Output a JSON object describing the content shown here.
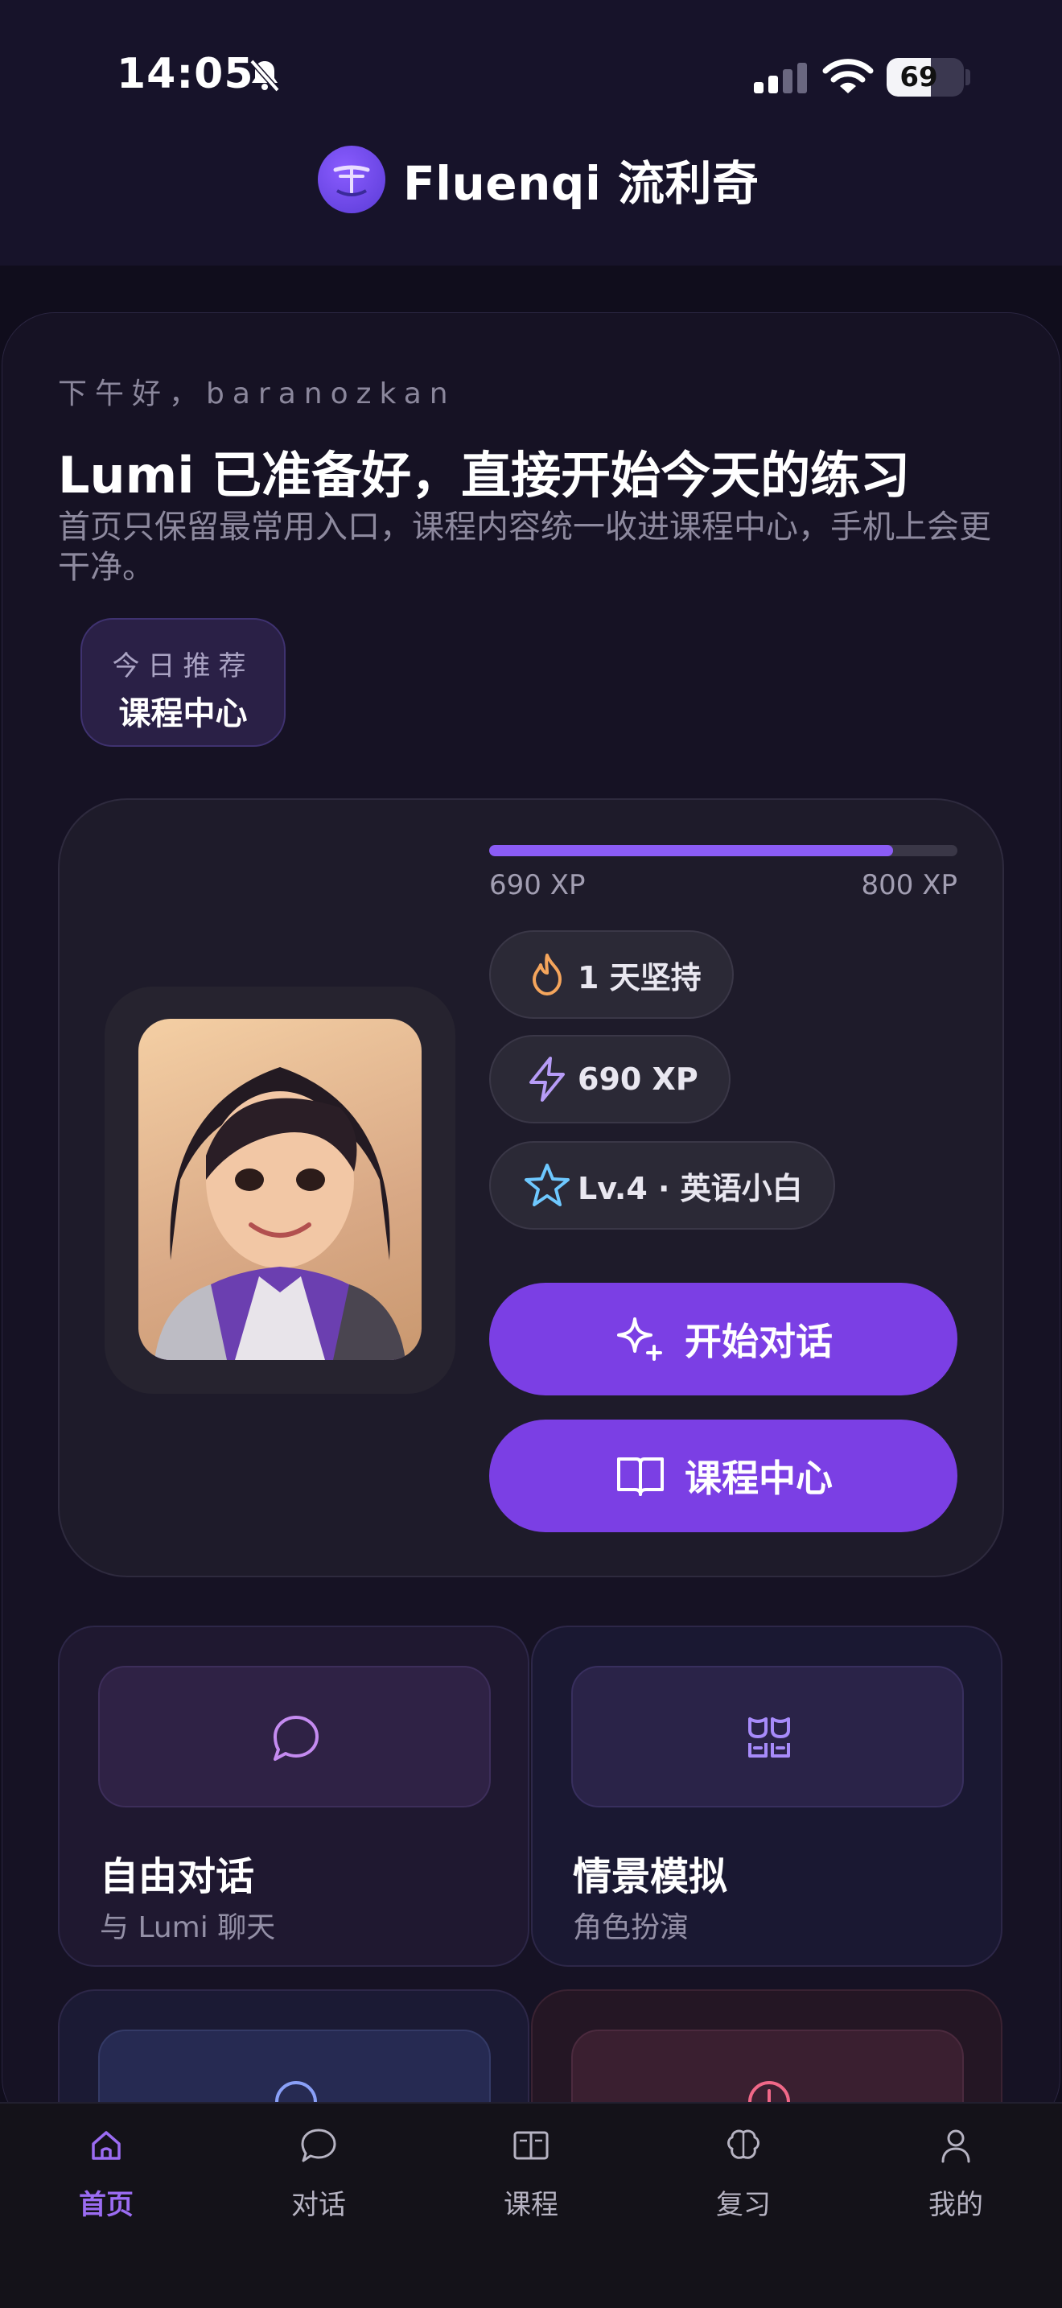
{
  "status": {
    "time": "14:05",
    "battery": "69"
  },
  "brand": {
    "name": "Fluenqi 流利奇"
  },
  "greeting": "下午好，baranozkan",
  "headline": "Lumi 已准备好，直接开始今天的练习",
  "subline": "首页只保留最常用入口，课程内容统一收进课程中心，手机上会更干净。",
  "recommend": {
    "label": "今日推荐",
    "value": "课程中心"
  },
  "xp": {
    "current": "690 XP",
    "target": "800 XP",
    "progress": 0.8625
  },
  "stats": [
    {
      "icon": "flame-icon",
      "text": "1 天坚持",
      "color": "#f5a55c"
    },
    {
      "icon": "lightning-icon",
      "text": "690 XP",
      "color": "#b79cf7"
    },
    {
      "icon": "star-icon",
      "text": "Lv.4 · 英语小白",
      "color": "#6ec8ff"
    }
  ],
  "actions": {
    "start_chat": "开始对话",
    "course_center": "课程中心"
  },
  "features": [
    {
      "title": "自由对话",
      "subtitle": "与 Lumi 聊天",
      "icon": "chat-bubble-icon"
    },
    {
      "title": "情景模拟",
      "subtitle": "角色扮演",
      "icon": "theater-masks-icon"
    }
  ],
  "tabs": [
    {
      "label": "首页",
      "icon": "home-icon",
      "active": true
    },
    {
      "label": "对话",
      "icon": "chat-icon"
    },
    {
      "label": "课程",
      "icon": "book-icon"
    },
    {
      "label": "复习",
      "icon": "brain-icon"
    },
    {
      "label": "我的",
      "icon": "user-icon"
    }
  ],
  "colors": {
    "accent": "#7b3fe4",
    "background": "#100d1c"
  }
}
